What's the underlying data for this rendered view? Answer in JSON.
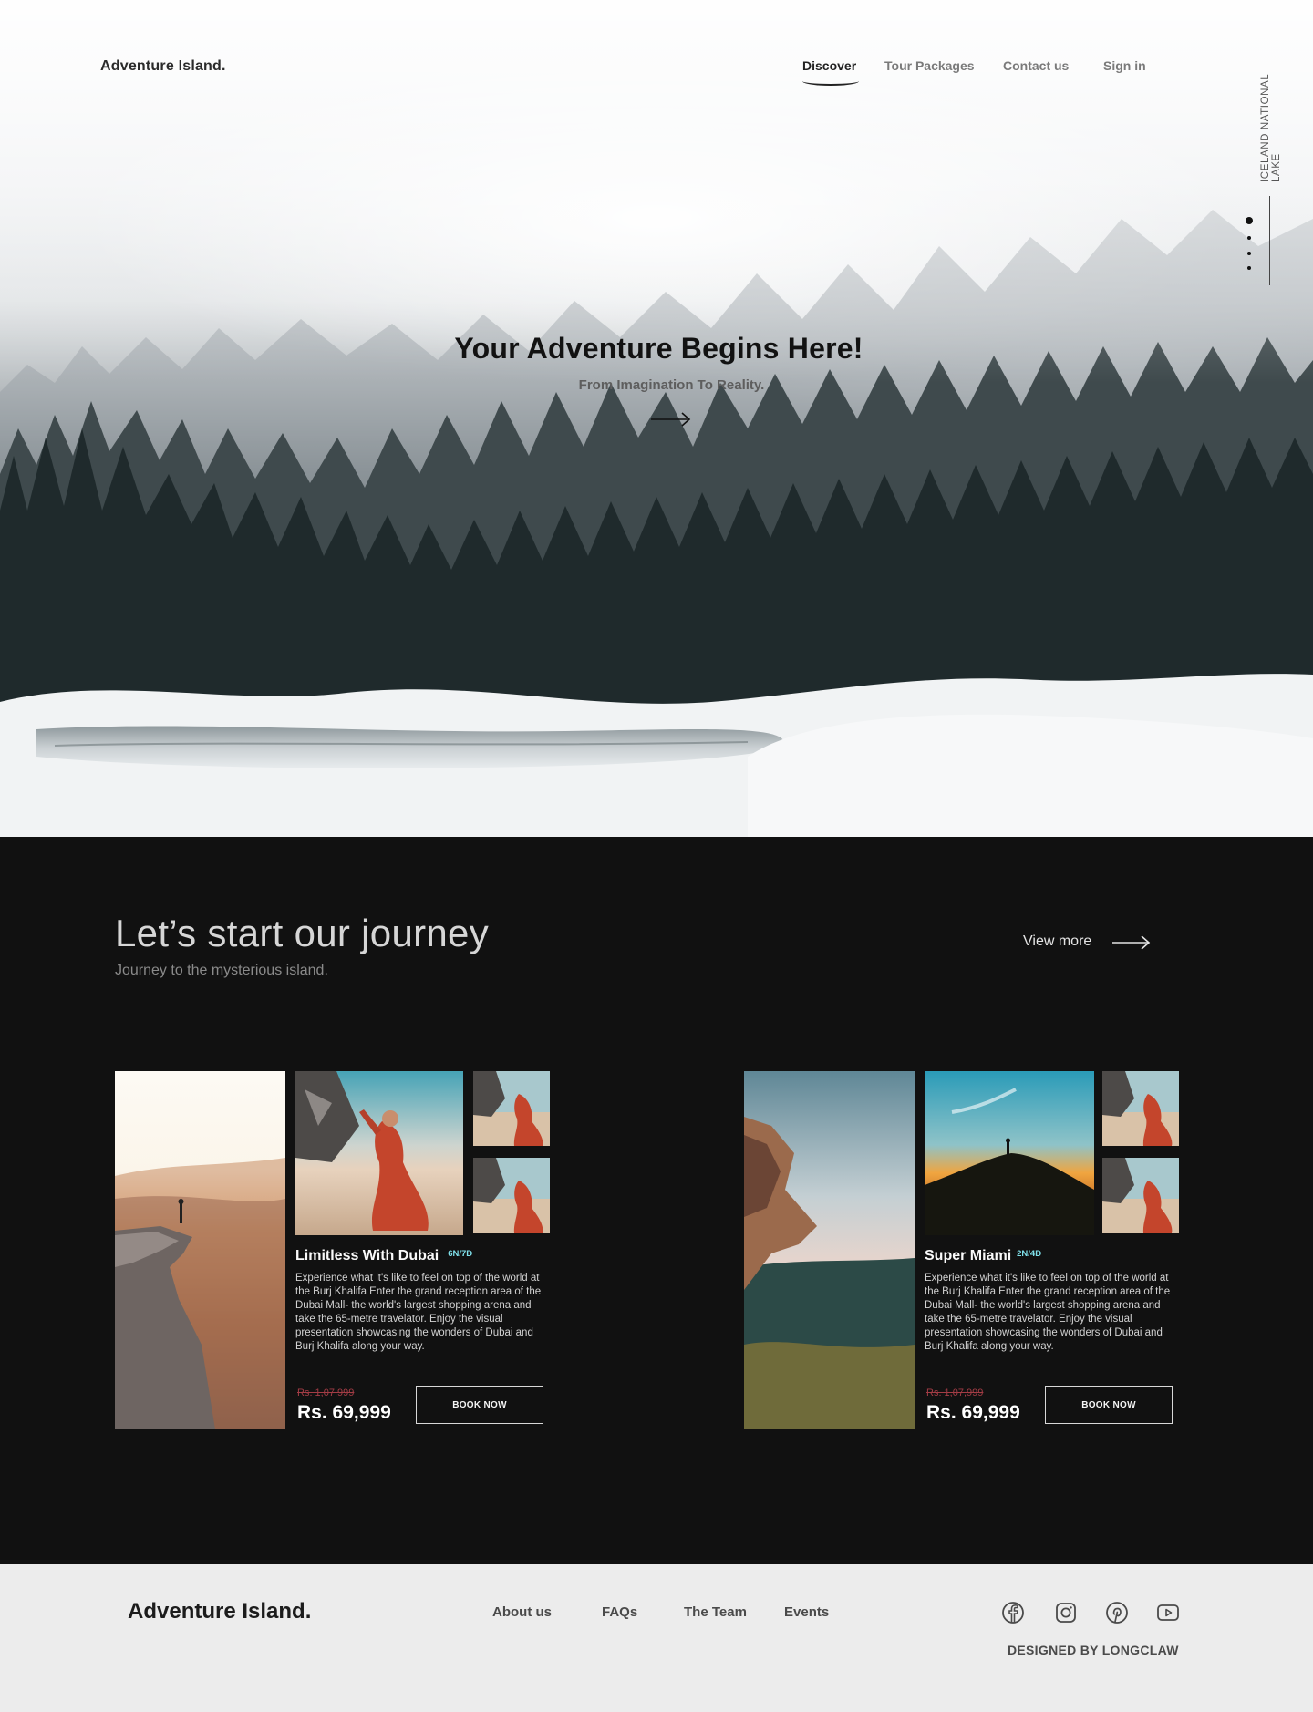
{
  "hero": {
    "logo": "Adventure Island.",
    "nav": {
      "discover": "Discover",
      "tour_packages": "Tour Packages",
      "contact_us": "Contact us",
      "sign_in": "Sign in"
    },
    "side_label": "ICELAND NATIONAL LAKE",
    "slides_total": 4,
    "slide_active": 1,
    "title": "Your Adventure Begins Here!",
    "subtitle": "From Imagination To Reality."
  },
  "journey": {
    "title": "Let’s start our journey",
    "subtitle": "Journey to the mysterious island.",
    "view_more": "View more",
    "cards": [
      {
        "title": "Limitless With Dubai",
        "badge": "6N/7D",
        "description": " Experience what it's like to feel on top of the world at the Burj Khalifa Enter the grand reception area of the Dubai Mall- the world's largest shopping arena and take the 65-metre travelator. Enjoy the visual presentation showcasing the wonders of Dubai and Burj Khalifa along your way.",
        "old_price": "Rs. 1,07,999",
        "price": "Rs. 69,999",
        "button": "BOOK NOW"
      },
      {
        "title": "Super Miami",
        "badge": "2N/4D",
        "description": " Experience what it's like to feel on top of the world at the Burj Khalifa Enter the grand reception area of the Dubai Mall- the world's largest shopping arena and take the 65-metre travelator. Enjoy the visual presentation showcasing the wonders of Dubai and Burj Khalifa along your way.",
        "old_price": "Rs. 1,07,999",
        "price": "Rs. 69,999",
        "button": "BOOK NOW"
      }
    ]
  },
  "footer": {
    "logo": "Adventure Island.",
    "links": {
      "about": "About us",
      "faqs": "FAQs",
      "team": "The Team",
      "events": "Events"
    },
    "social_icons": [
      "facebook-icon",
      "instagram-icon",
      "pinterest-icon",
      "youtube-icon"
    ],
    "credit": "DESIGNED BY LONGCLAW"
  },
  "colors": {
    "dark_bg": "#111111",
    "footer_bg": "#ececec",
    "badge": "#7fe0ea",
    "old_price": "#a33c45"
  }
}
